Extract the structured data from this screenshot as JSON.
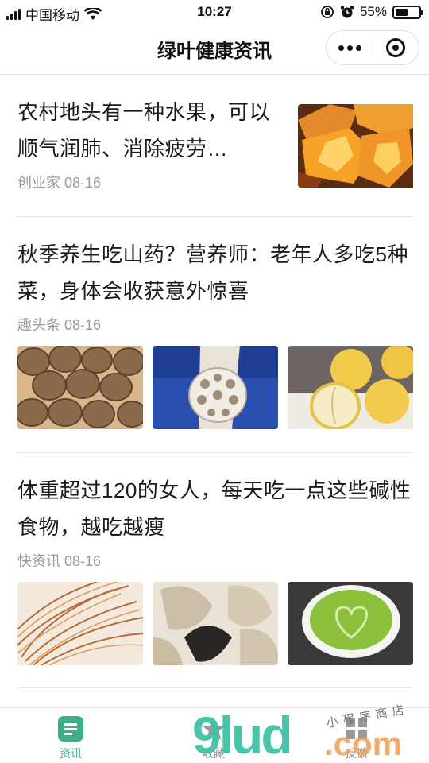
{
  "status_bar": {
    "carrier": "中国移动",
    "time": "10:27",
    "battery_percent": "55%",
    "battery_level": 0.55
  },
  "navbar": {
    "title": "绿叶健康资讯"
  },
  "articles": [
    {
      "title": "农村地头有一种水果，可以顺气润肺、消除疲劳…",
      "source": "创业家",
      "date": "08-16"
    },
    {
      "title": "秋季养生吃山药？营养师：老年人多吃5种菜，身体会收获意外惊喜",
      "source": "趣头条",
      "date": "08-16"
    },
    {
      "title": "体重超过120的女人，每天吃一点这些碱性食物，越吃越瘦",
      "source": "快资讯",
      "date": "08-16"
    }
  ],
  "tabbar": {
    "tabs": [
      {
        "label": "资讯",
        "icon": "news-icon",
        "active": true
      },
      {
        "label": "收藏",
        "icon": "star-icon",
        "active": false
      },
      {
        "label": "反馈",
        "icon": "feedback-icon",
        "active": false
      }
    ]
  },
  "watermark": {
    "brand": "9lud",
    "domain": ".com",
    "handwriting": "小程序商店"
  },
  "colors": {
    "accent": "#3fae8a",
    "watermark_green": "#3fc1a7",
    "watermark_orange": "#f1a35a"
  }
}
